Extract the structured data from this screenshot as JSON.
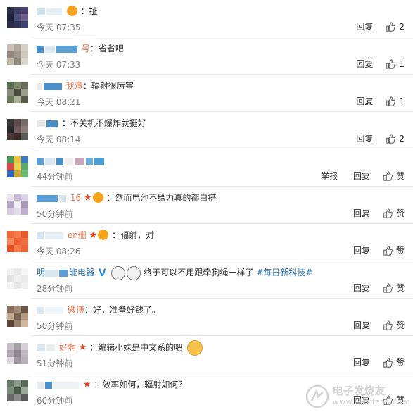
{
  "comments": [
    {
      "name_tail": "",
      "badges": [
        "vip"
      ],
      "text": "：扯",
      "time": "今天 07:35",
      "reply": "回复",
      "like_count": "2",
      "report": ""
    },
    {
      "name_tail": "号",
      "badges": [],
      "text": "：省省吧",
      "time": "今天 07:33",
      "reply": "回复",
      "like_count": "1",
      "report": ""
    },
    {
      "name_tail": "我意",
      "badges": [],
      "text": "：辐射很厉害",
      "time": "今天 08:21",
      "reply": "回复",
      "like_count": "1",
      "report": ""
    },
    {
      "name_tail": "",
      "badges": [],
      "text": "：不关机不爆炸就挺好",
      "time": "今天 08:14",
      "reply": "回复",
      "like_count": "2",
      "report": ""
    },
    {
      "name_tail": "",
      "badges": [],
      "text": "",
      "time": "44分钟前",
      "reply": "回复",
      "like_count": "赞",
      "report": "举报"
    },
    {
      "name_tail": "16",
      "badges": [
        "star",
        "vip"
      ],
      "text": "：然而电池不给力真的都白搭",
      "time": "50分钟前",
      "reply": "回复",
      "like_count": "赞",
      "report": ""
    },
    {
      "name_tail": "en珊",
      "badges": [
        "star",
        "vip"
      ],
      "text": "：辐射，对",
      "time": "今天 08:26",
      "reply": "回复",
      "like_count": "赞",
      "report": ""
    },
    {
      "name_head": "明",
      "name_tail": "能电器",
      "badges": [
        "v"
      ],
      "text": "终于可以不用跟牵狗绳一样了",
      "link": "#每日新科技#",
      "time": "28分钟前",
      "reply": "回复",
      "like_count": "赞",
      "report": ""
    },
    {
      "name_tail": "微博",
      "badges": [],
      "text": "：好，准备好钱了。",
      "time": "50分钟前",
      "reply": "回复",
      "like_count": "赞",
      "report": ""
    },
    {
      "name_tail": "好啊",
      "badges": [
        "star"
      ],
      "text": "：编辑小妹是中文系的吧",
      "time": "51分钟前",
      "reply": "回复",
      "like_count": "赞",
      "report": ""
    },
    {
      "name_tail": "",
      "badges": [
        "star"
      ],
      "text": "：效率如何，辐射如何？",
      "time": "60分钟前",
      "reply": "回复",
      "like_count": "赞",
      "report": ""
    }
  ],
  "watermark": {
    "title": "电子发烧友",
    "sub": "www.elecfans.com"
  },
  "colors": {
    "username": "#eb7350",
    "link": "#2773b5",
    "time": "#808080"
  }
}
